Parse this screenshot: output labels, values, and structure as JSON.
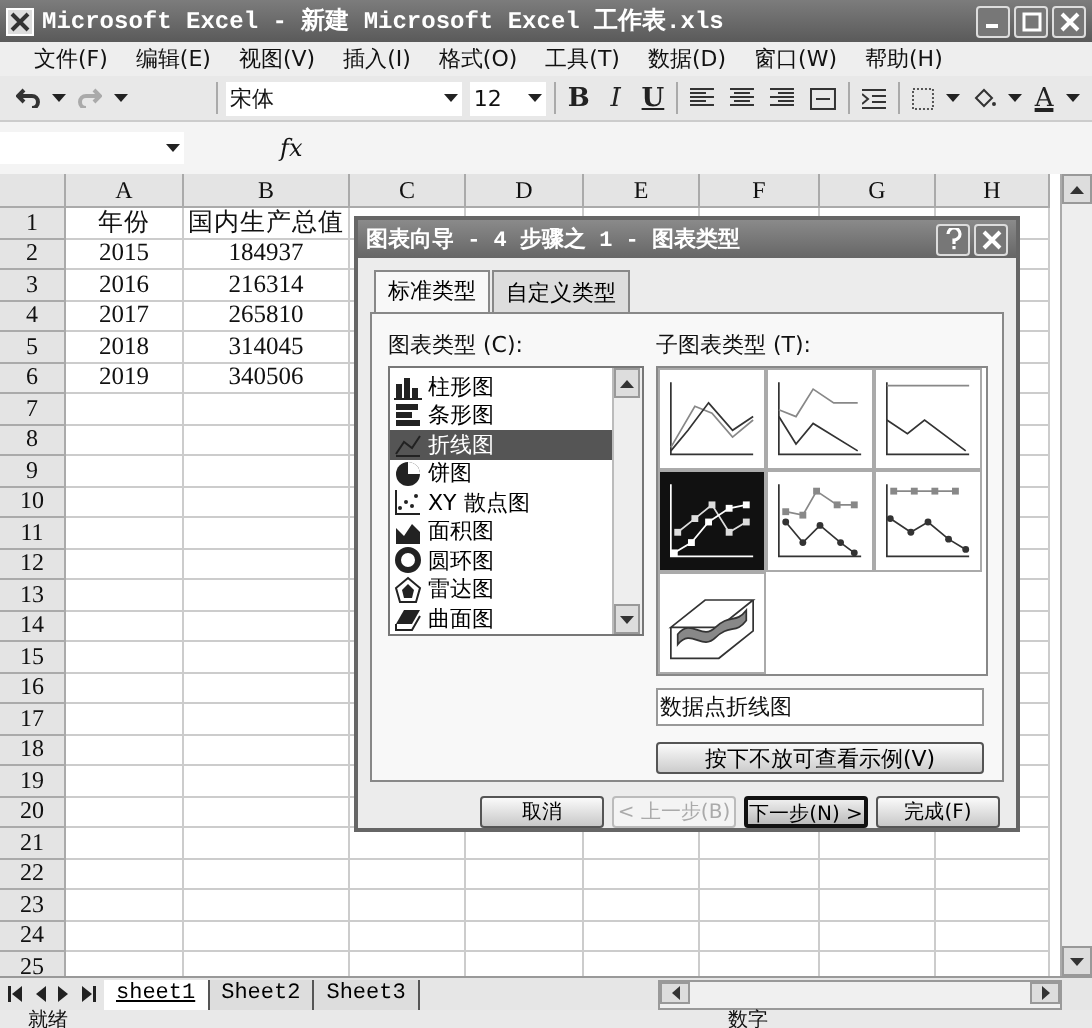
{
  "window": {
    "title": "Microsoft Excel - 新建 Microsoft Excel 工作表.xls"
  },
  "menu": [
    "文件(F)",
    "编辑(E)",
    "视图(V)",
    "插入(I)",
    "格式(O)",
    "工具(T)",
    "数据(D)",
    "窗口(W)",
    "帮助(H)"
  ],
  "toolbar": {
    "font": "宋体",
    "size": "12",
    "format_buttons": [
      {
        "label": "B",
        "kind": "bold"
      },
      {
        "label": "I",
        "kind": "italic"
      },
      {
        "label": "U",
        "kind": "underline"
      }
    ],
    "font_color_label": "A"
  },
  "formula_bar": {
    "function_label": "fx"
  },
  "sheet": {
    "columns": [
      "A",
      "B",
      "C",
      "D",
      "E",
      "F",
      "G",
      "H"
    ],
    "rows": [
      {
        "header": "1",
        "cells": [
          "年份",
          "国内生产总值"
        ]
      },
      {
        "header": "2",
        "cells": [
          "2015",
          "184937"
        ]
      },
      {
        "header": "3",
        "cells": [
          "2016",
          "216314"
        ]
      },
      {
        "header": "4",
        "cells": [
          "2017",
          "265810"
        ]
      },
      {
        "header": "5",
        "cells": [
          "2018",
          "314045"
        ]
      },
      {
        "header": "6",
        "cells": [
          "2019",
          "340506"
        ]
      },
      {
        "header": "7"
      },
      {
        "header": "8"
      },
      {
        "header": "9"
      },
      {
        "header": "10"
      },
      {
        "header": "11"
      },
      {
        "header": "12"
      },
      {
        "header": "13"
      },
      {
        "header": "14"
      },
      {
        "header": "15"
      },
      {
        "header": "16"
      },
      {
        "header": "17"
      },
      {
        "header": "18"
      },
      {
        "header": "19"
      },
      {
        "header": "20"
      },
      {
        "header": "21"
      },
      {
        "header": "22"
      },
      {
        "header": "23"
      },
      {
        "header": "24"
      },
      {
        "header": "25"
      }
    ]
  },
  "sheet_tabs": [
    {
      "label": "sheet1",
      "selected": true
    },
    {
      "label": "Sheet2",
      "selected": false
    },
    {
      "label": "Sheet3",
      "selected": false
    }
  ],
  "status_bar": {
    "status": "就绪",
    "mode": "数字"
  },
  "dialog": {
    "title": "图表向导 - 4 步骤之 1 - 图表类型",
    "tabs": [
      {
        "label": "标准类型",
        "selected": true
      },
      {
        "label": "自定义类型",
        "selected": false
      }
    ],
    "chart_types_label": "图表类型 (C):",
    "chart_types": [
      {
        "label": "柱形图",
        "kind": "column",
        "selected": false
      },
      {
        "label": "条形图",
        "kind": "bar",
        "selected": false
      },
      {
        "label": "折线图",
        "kind": "line",
        "selected": true
      },
      {
        "label": "饼图",
        "kind": "pie",
        "selected": false
      },
      {
        "label": "XY 散点图",
        "kind": "scatter",
        "selected": false
      },
      {
        "label": "面积图",
        "kind": "area",
        "selected": false
      },
      {
        "label": "圆环图",
        "kind": "doughnut",
        "selected": false
      },
      {
        "label": "雷达图",
        "kind": "radar",
        "selected": false
      },
      {
        "label": "曲面图",
        "kind": "surface",
        "selected": false
      }
    ],
    "subtypes_label": "子图表类型 (T):",
    "subtypes": [
      {
        "kind": "line",
        "selected": false
      },
      {
        "kind": "stacked",
        "selected": false
      },
      {
        "kind": "percent",
        "selected": false
      },
      {
        "kind": "markers",
        "selected": true
      },
      {
        "kind": "stackmarkers",
        "selected": false
      },
      {
        "kind": "percentmarkers",
        "selected": false
      },
      {
        "kind": "ribbon",
        "selected": false
      }
    ],
    "description": "数据点折线图",
    "preview_button": "按下不放可查看示例(V)",
    "buttons": [
      {
        "label": "取消",
        "disabled": false,
        "default": false
      },
      {
        "label": "< 上一步(B)",
        "disabled": true,
        "default": false
      },
      {
        "label": "下一步(N) >",
        "disabled": false,
        "default": true
      },
      {
        "label": "完成(F)",
        "disabled": false,
        "default": false
      }
    ]
  }
}
